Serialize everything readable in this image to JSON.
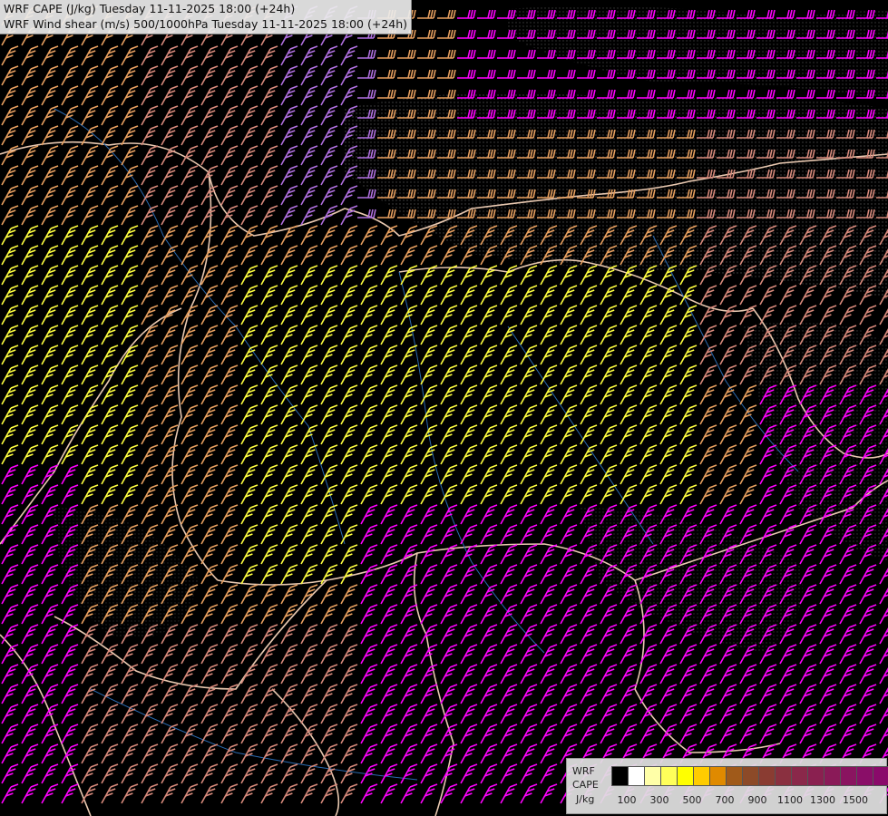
{
  "header": {
    "line1": "WRF CAPE (J/kg) Tuesday 11-11-2025 18:00 (+24h)",
    "line2": "WRF Wind shear (m/s) 500/1000hPa Tuesday 11-11-2025 18:00 (+24h)"
  },
  "legend": {
    "line1": "WRF",
    "line2": "CAPE",
    "line3": "J/kg",
    "colors": [
      "#000000",
      "#ffffff",
      "#ffffa8",
      "#ffff5a",
      "#ffff00",
      "#ffcc00",
      "#e08a00",
      "#a05a1a",
      "#8c4a28",
      "#8a3c32",
      "#8a3040",
      "#8a284a",
      "#8a2050",
      "#8a1a58",
      "#8a1460",
      "#8a0e68",
      "#8a0a6a"
    ],
    "ticks": [
      "100",
      "300",
      "500",
      "700",
      "900",
      "1100",
      "1300",
      "1500"
    ]
  },
  "map": {
    "barb_colors": {
      "weak": "#d88a7c",
      "moderate": "#e8a060",
      "strong": "#ffff40",
      "very_strong": "#ff00ff",
      "upper": "#b070e0"
    }
  }
}
